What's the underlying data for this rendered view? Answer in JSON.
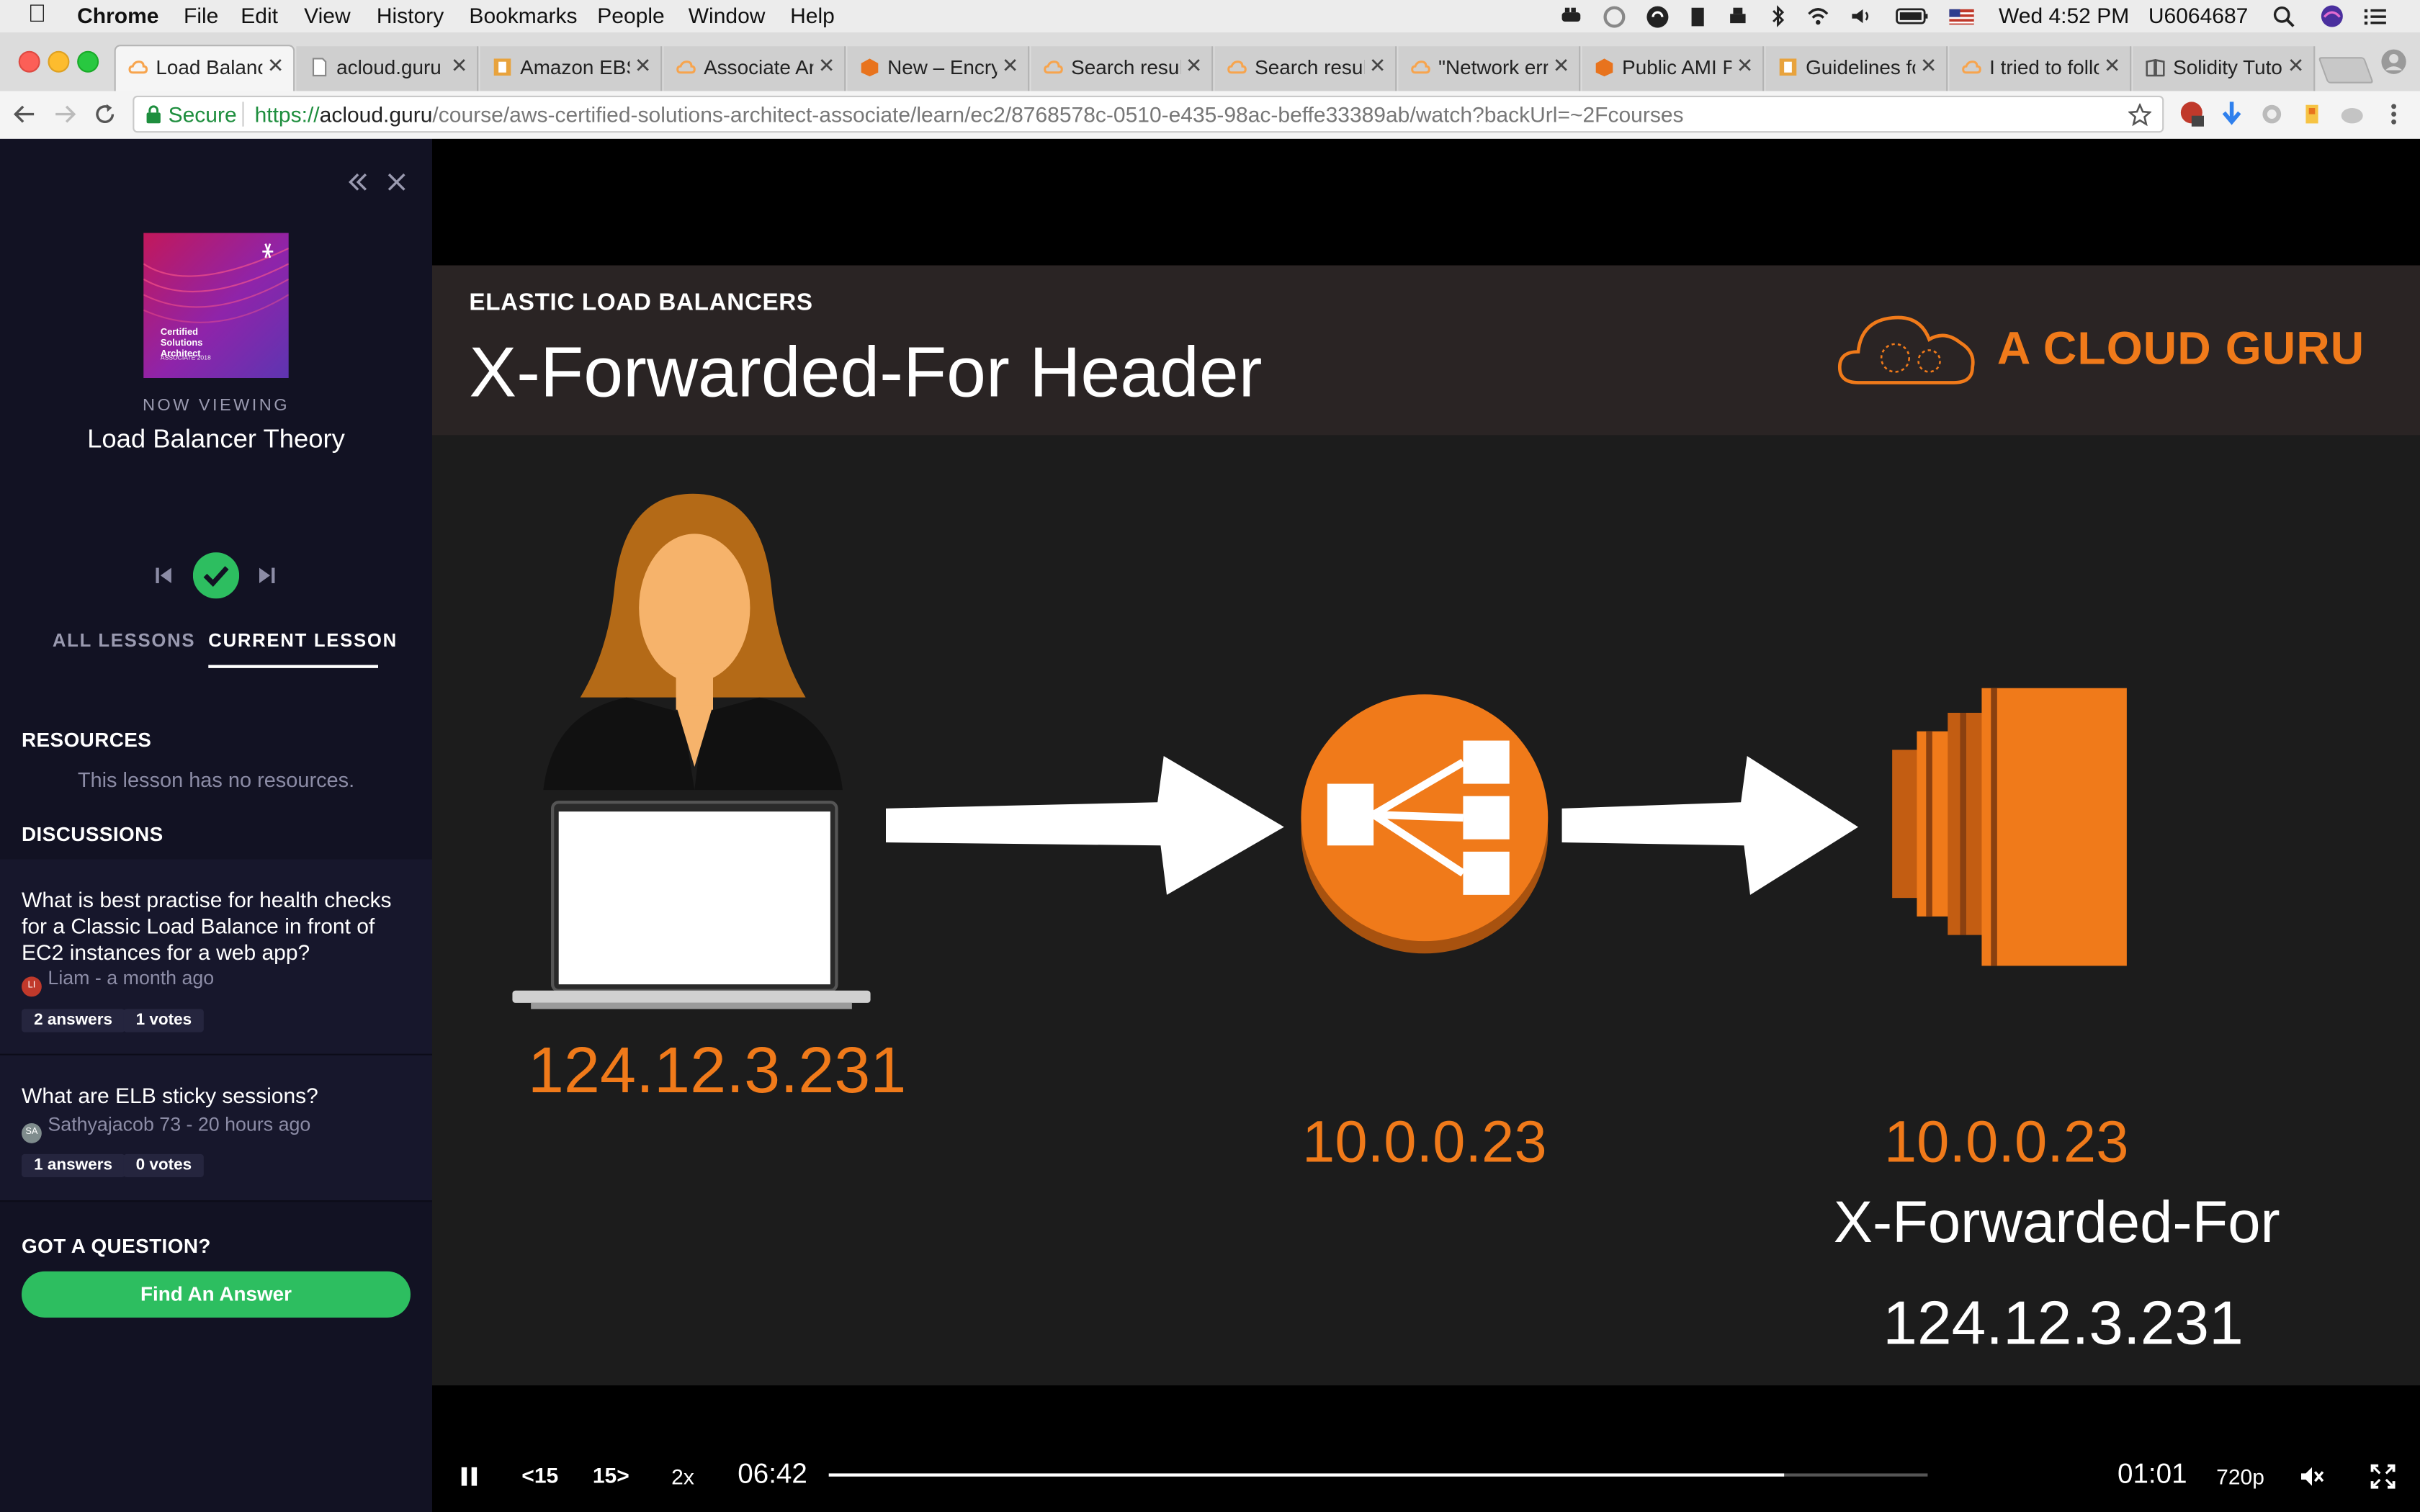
{
  "menubar": {
    "apple": "",
    "app": "Chrome",
    "items": [
      "File",
      "Edit",
      "View",
      "History",
      "Bookmarks",
      "People",
      "Window",
      "Help"
    ],
    "clock": "Wed 4:52 PM",
    "user": "U6064687"
  },
  "tabs": [
    {
      "label": "Load Balancer",
      "fav": "#f7a44d"
    },
    {
      "label": "acloud.guru",
      "fav": "#bbbbbb"
    },
    {
      "label": "Amazon EBS",
      "fav": "#e8a33d"
    },
    {
      "label": "Associate Ar",
      "fav": "#f7a44d"
    },
    {
      "label": "New – Encryp",
      "fav": "#e8731d"
    },
    {
      "label": "Search result",
      "fav": "#f7a44d"
    },
    {
      "label": "Search result",
      "fav": "#f7a44d"
    },
    {
      "label": "\"Network erro",
      "fav": "#f7a44d"
    },
    {
      "label": "Public AMI P",
      "fav": "#e8731d"
    },
    {
      "label": "Guidelines fo",
      "fav": "#e8a33d"
    },
    {
      "label": "I tried to follo",
      "fav": "#f7a44d"
    },
    {
      "label": "Solidity Tutor",
      "fav": "#888888"
    }
  ],
  "address": {
    "secure_label": "Secure",
    "scheme": "https://",
    "domain": "acloud.guru",
    "path": "/course/aws-certified-solutions-architect-associate/learn/ec2/8768578c-0510-e435-98ac-beffe33389ab/watch?backUrl=~2Fcourses"
  },
  "sidebar": {
    "thumb_title": "Certified Solutions Architect",
    "thumb_sub": "ASSOCIATE 2018",
    "now_viewing_label": "NOW VIEWING",
    "lesson_title": "Load Balancer Theory",
    "tab_all": "ALL LESSONS",
    "tab_current": "CURRENT LESSON",
    "resources_head": "RESOURCES",
    "resources_empty": "This lesson has no resources.",
    "discussions_head": "DISCUSSIONS",
    "discussions": [
      {
        "question": "What is best practise for health checks for a Classic Load Balance in front of EC2 instances for a web app?",
        "avatar": "LI",
        "avatar_color": "#c0392b",
        "meta": "Liam - a month ago",
        "answers": "2 answers",
        "votes": "1 votes"
      },
      {
        "question": "What are ELB sticky sessions?",
        "avatar": "SA",
        "avatar_color": "#7f8c8d",
        "meta": "Sathyajacob 73 - 20 hours ago",
        "answers": "1 answers",
        "votes": "0 votes"
      }
    ],
    "got_question": "GOT A QUESTION?",
    "find_answer": "Find An Answer"
  },
  "slide": {
    "section": "ELASTIC LOAD BALANCERS",
    "title": "X-Forwarded-For Header",
    "brand": "A CLOUD GURU",
    "client_ip": "124.12.3.231",
    "elb_ip": "10.0.0.23",
    "ec2_ip": "10.0.0.23",
    "xff_label": "X-Forwarded-For",
    "xff_value": "124.12.3.231"
  },
  "player": {
    "back": "15",
    "fwd": "15",
    "speed": "2x",
    "elapsed": "06:42",
    "remaining": "01:01",
    "quality": "720p",
    "progress": 0.87
  },
  "colors": {
    "accent_green": "#2dbe60",
    "orange": "#f07a1a"
  }
}
